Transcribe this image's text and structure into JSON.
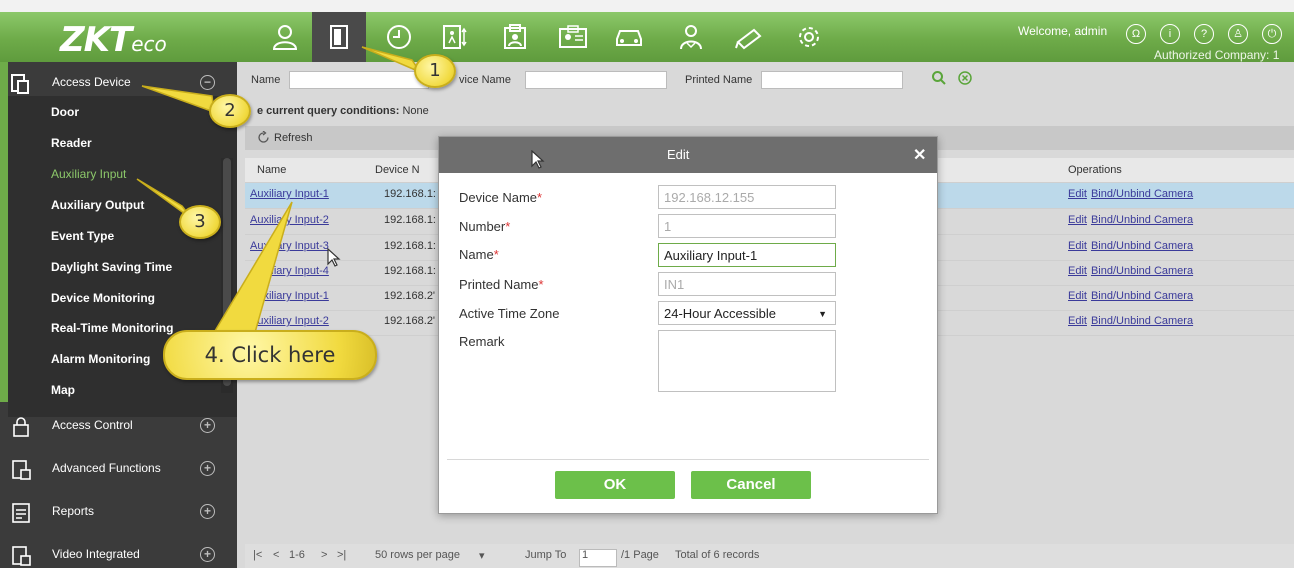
{
  "header": {
    "logo_main": "ZKT",
    "logo_sub": "eco",
    "welcome": "Welcome, admin",
    "company": "Authorized Company: 1",
    "module_icons": [
      "personnel-icon",
      "access-door-icon",
      "attendance-clock-icon",
      "elevator-icon",
      "visitor-icon",
      "parking-car-icon",
      "patrol-icon",
      "video-camera-icon",
      "system-gear-icon"
    ],
    "right_icons": [
      "user-circle-icon",
      "info-circle-icon",
      "help-circle-icon",
      "account-circle-icon",
      "power-icon"
    ]
  },
  "sidebar": {
    "section_access_device": "Access Device",
    "items": [
      "Door",
      "Reader",
      "Auxiliary Input",
      "Auxiliary Output",
      "Event Type",
      "Daylight Saving Time",
      "Device Monitoring",
      "Real-Time Monitoring",
      "Alarm Monitoring",
      "Map"
    ],
    "active_item": "Auxiliary Input",
    "sections": [
      "Access Control",
      "Advanced Functions",
      "Reports",
      "Video Integrated"
    ]
  },
  "search": {
    "name_label": "Name",
    "device_name_label": "vice Name",
    "printed_name_label": "Printed Name"
  },
  "query_conditions": {
    "label": "e current query conditions:",
    "value": "None"
  },
  "toolbar": {
    "refresh_label": "Refresh"
  },
  "table": {
    "headers": {
      "name": "Name",
      "device": "Device N",
      "operations": "Operations"
    },
    "rows": [
      {
        "name": "Auxiliary Input-1",
        "device": "192.168.1:"
      },
      {
        "name": "Auxiliary Input-2",
        "device": "192.168.1:"
      },
      {
        "name": "Auxiliary Input-3",
        "device": "192.168.1:"
      },
      {
        "name": "Auxiliary Input-4",
        "device": "192.168.1:"
      },
      {
        "name": "Auxiliary Input-1",
        "device": "192.168.2'"
      },
      {
        "name": "Auxiliary Input-2",
        "device": "192.168.2'"
      }
    ],
    "op_edit": "Edit",
    "op_bind": "Bind/Unbind Camera"
  },
  "pager": {
    "range": "1-6",
    "rows_per_page": "50 rows per page",
    "jump_to": "Jump To",
    "page_value": "1",
    "page_total": "/1 Page",
    "total": "Total of 6 records"
  },
  "modal": {
    "title": "Edit",
    "fields": {
      "device_name": {
        "label": "Device Name",
        "value": "192.168.12.155"
      },
      "number": {
        "label": "Number",
        "value": "1"
      },
      "name": {
        "label": "Name",
        "value": "Auxiliary Input-1"
      },
      "printed_name": {
        "label": "Printed Name",
        "value": "IN1"
      },
      "time_zone": {
        "label": "Active Time Zone",
        "value": "24-Hour Accessible"
      },
      "remark": {
        "label": "Remark"
      }
    },
    "required_mark": "*",
    "ok": "OK",
    "cancel": "Cancel"
  },
  "callouts": {
    "c1": "1",
    "c2": "2",
    "c3": "3",
    "c4": "4. Click here"
  },
  "colors": {
    "brand_green": "#6eab49",
    "sidebar_dark": "#3b3b3b",
    "callout_yellow": "#f1da3f",
    "button_green": "#6cc04a"
  }
}
